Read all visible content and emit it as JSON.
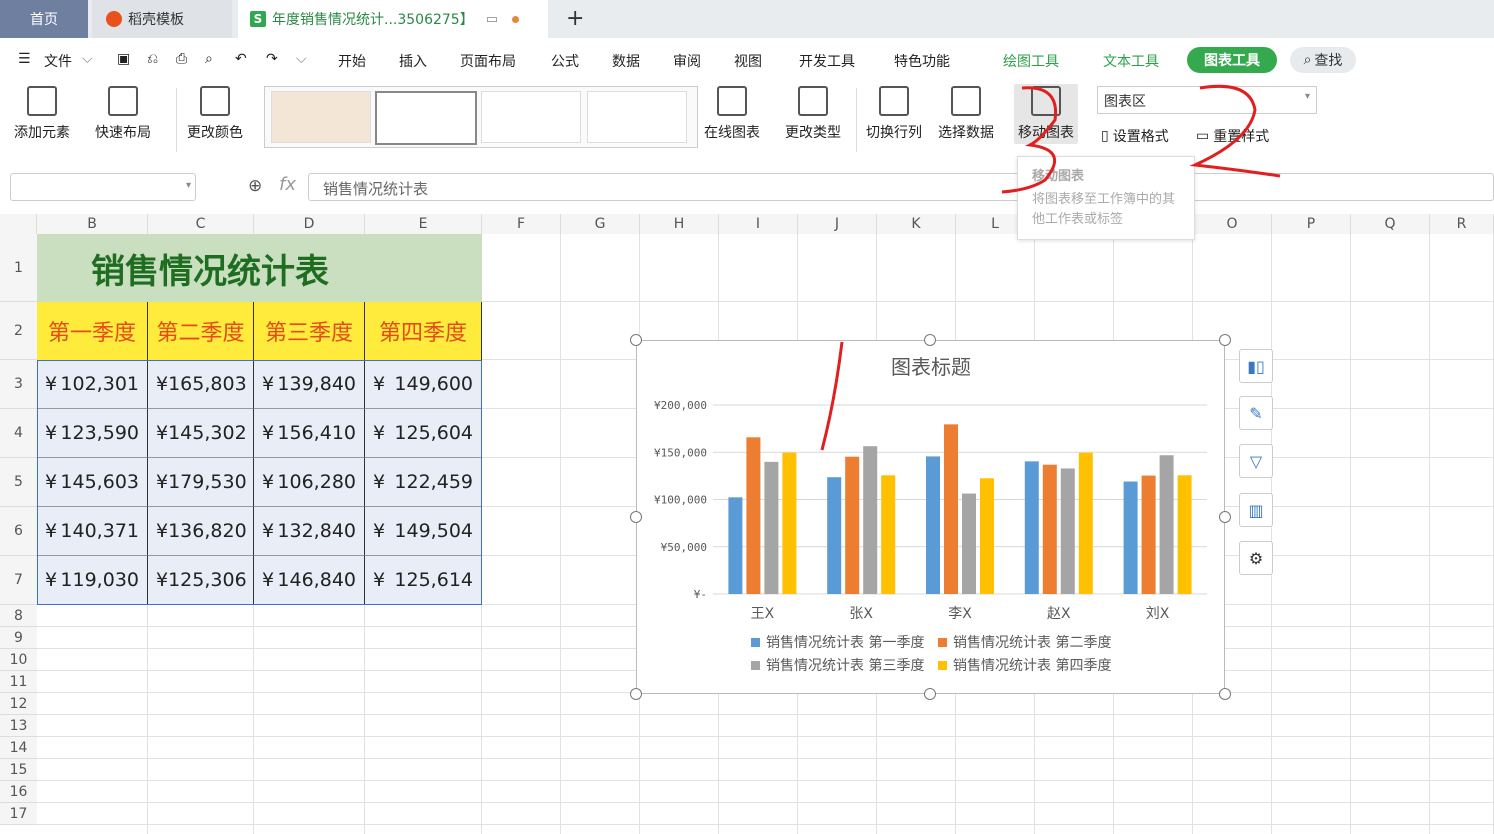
{
  "tabs": {
    "home": "首页",
    "daoke": "稻壳模板",
    "doc": "年度销售情况统计...3506275】",
    "new": "+"
  },
  "menu": {
    "file": "文件",
    "items": [
      "开始",
      "插入",
      "页面布局",
      "公式",
      "数据",
      "审阅",
      "视图",
      "开发工具",
      "特色功能"
    ],
    "draw_tools": "绘图工具",
    "text_tools": "文本工具",
    "chart_tools": "图表工具",
    "search": "查找"
  },
  "ribbon": {
    "add_element": "添加元素",
    "quick_layout": "快速布局",
    "change_color": "更改颜色",
    "online_chart": "在线图表",
    "change_type": "更改类型",
    "switch_row_col": "切换行列",
    "select_data": "选择数据",
    "move_chart": "移动图表",
    "chart_area": "图表区",
    "set_format": "设置格式",
    "reset_style": "重置样式"
  },
  "tooltip": {
    "title": "移动图表",
    "body": "将图表移至工作簿中的其他工作表或标签"
  },
  "formula": {
    "fx": "fx",
    "value": "销售情况统计表"
  },
  "columns": [
    "B",
    "C",
    "D",
    "E",
    "F",
    "G",
    "H",
    "I",
    "J",
    "K",
    "L",
    "M",
    "N",
    "O",
    "P",
    "Q",
    "R"
  ],
  "rows": [
    "1",
    "2",
    "3",
    "4",
    "5",
    "6",
    "7",
    "8",
    "9",
    "10",
    "11",
    "12",
    "13",
    "14",
    "15",
    "16",
    "17"
  ],
  "table": {
    "title": "销售情况统计表",
    "headers": [
      "第一季度",
      "第二季度",
      "第三季度",
      "第四季度"
    ],
    "currency": "¥",
    "rows": [
      [
        "102,301",
        "165,803",
        "139,840",
        "149,600"
      ],
      [
        "123,590",
        "145,302",
        "156,410",
        "125,604"
      ],
      [
        "145,603",
        "179,530",
        "106,280",
        "122,459"
      ],
      [
        "140,371",
        "136,820",
        "132,840",
        "149,504"
      ],
      [
        "119,030",
        "125,306",
        "146,840",
        "125,614"
      ]
    ]
  },
  "colors": {
    "series": [
      "#5b9bd5",
      "#ed7d31",
      "#a5a5a5",
      "#ffc000"
    ],
    "accent_green": "#35a94e",
    "annotation_red": "#e02020"
  },
  "chart_data": {
    "type": "bar",
    "title": "图表标题",
    "categories": [
      "王X",
      "张X",
      "李X",
      "赵X",
      "刘X"
    ],
    "series": [
      {
        "name": "销售情况统计表 第一季度",
        "values": [
          102301,
          123590,
          145603,
          140371,
          119030
        ]
      },
      {
        "name": "销售情况统计表 第二季度",
        "values": [
          165803,
          145302,
          179530,
          136820,
          125306
        ]
      },
      {
        "name": "销售情况统计表 第三季度",
        "values": [
          139840,
          156410,
          106280,
          132840,
          146840
        ]
      },
      {
        "name": "销售情况统计表 第四季度",
        "values": [
          149600,
          125604,
          122459,
          149504,
          125614
        ]
      }
    ],
    "yticks": [
      "¥-",
      "¥50,000",
      "¥100,000",
      "¥150,000",
      "¥200,000"
    ],
    "ylim": [
      0,
      200000
    ],
    "grid": true,
    "legend": "bottom"
  },
  "annotations": [
    "3",
    "2"
  ]
}
